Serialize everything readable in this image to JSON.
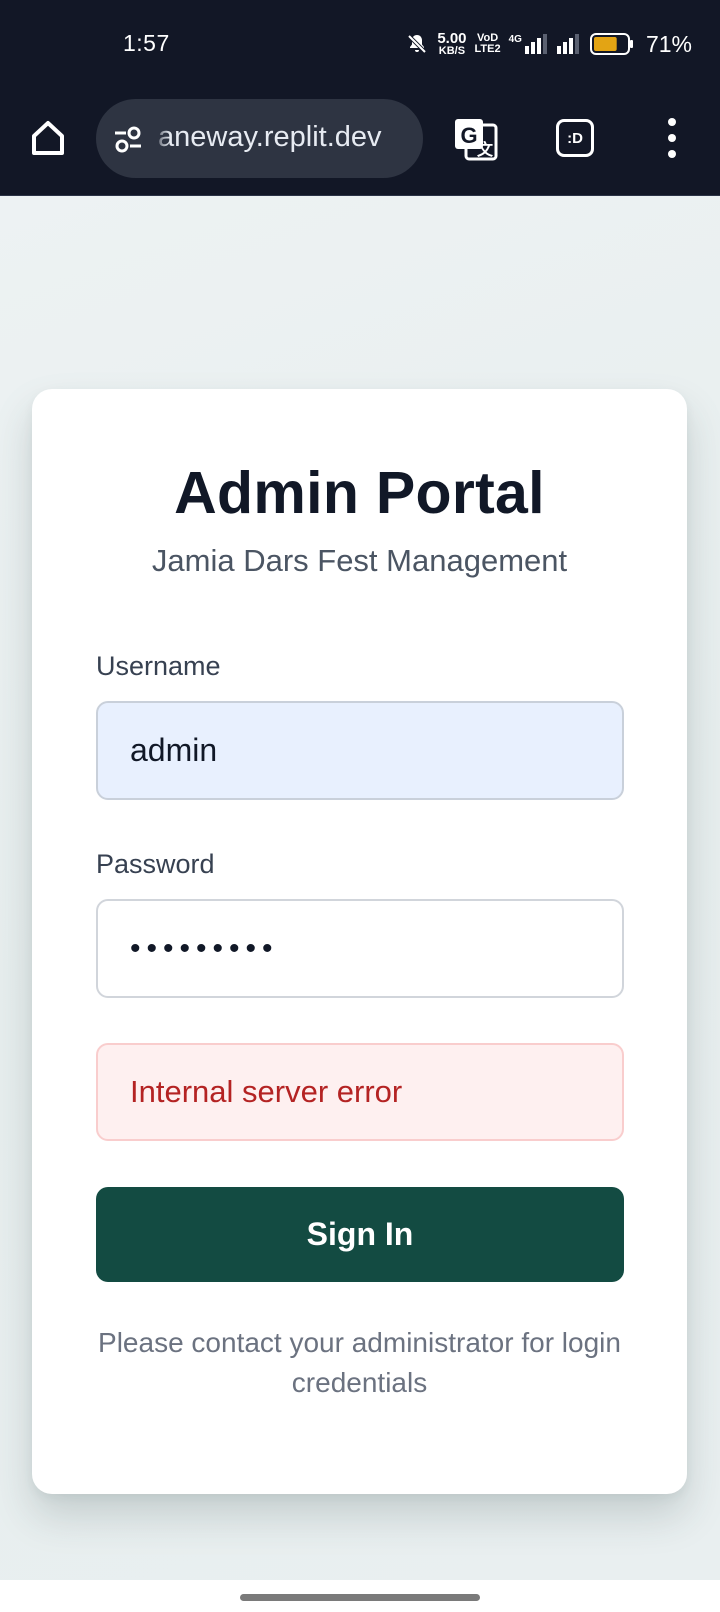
{
  "status_bar": {
    "time": "1:57",
    "net_speed_value": "5.00",
    "net_speed_unit": "KB/S",
    "volte_top": "VoD",
    "volte_bottom": "LTE2",
    "network_type": "4G",
    "battery_percent": "71%",
    "battery_level": 0.71,
    "battery_color": "#e3a414"
  },
  "browser": {
    "url": "aneway.replit.dev",
    "extension_label": ":D",
    "icons": [
      "home-icon",
      "site-settings-icon",
      "translate-icon",
      "extension-icon",
      "more-vert-icon"
    ]
  },
  "login": {
    "title": "Admin Portal",
    "subtitle": "Jamia Dars Fest Management",
    "username_label": "Username",
    "username_value": "admin",
    "password_label": "Password",
    "password_value": "•••••••••",
    "error_message": "Internal server error",
    "submit_label": "Sign In",
    "help_text": "Please contact your administrator for login credentials"
  },
  "colors": {
    "browser_chrome": "#121726",
    "primary_button": "#134b42",
    "error_text": "#b42323",
    "error_background": "#fef0f0",
    "autofill_background": "#e8f0fe"
  }
}
